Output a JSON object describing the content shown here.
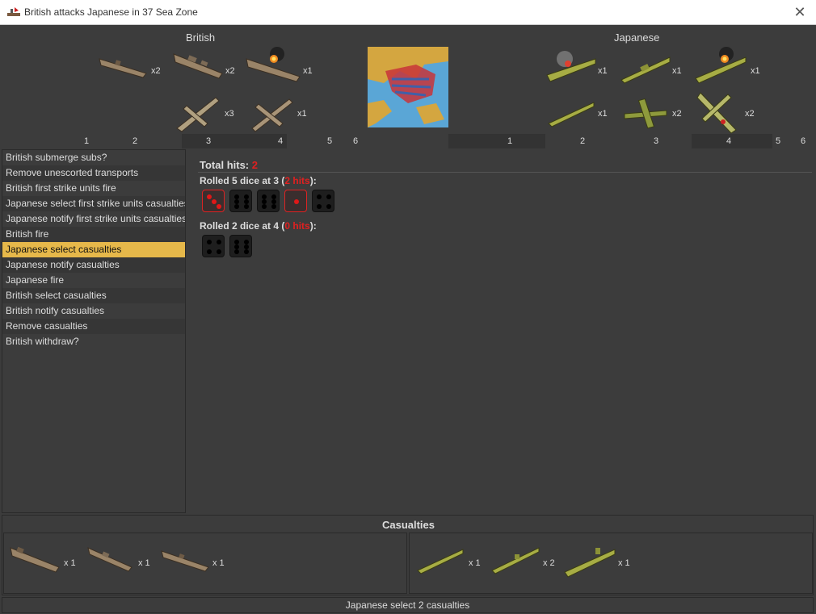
{
  "window": {
    "title": "British attacks Japanese in 37 Sea Zone",
    "close_label": "✕"
  },
  "british": {
    "label": "British",
    "units": [
      {
        "name": "submarine",
        "count": "x2"
      },
      {
        "name": "cruiser",
        "count": "x2"
      },
      {
        "name": "damaged-battleship",
        "count": "x1"
      },
      {
        "name": "fighter",
        "count": "x3"
      },
      {
        "name": "bomber",
        "count": "x1"
      }
    ]
  },
  "japanese": {
    "label": "Japanese",
    "units": [
      {
        "name": "damaged-carrier",
        "count": "x1"
      },
      {
        "name": "cruiser",
        "count": "x1"
      },
      {
        "name": "damaged-battleship",
        "count": "x1"
      },
      {
        "name": "destroyer",
        "count": "x1"
      },
      {
        "name": "tactical-bomber",
        "count": "x2"
      },
      {
        "name": "fighter",
        "count": "x2"
      }
    ]
  },
  "numbers": {
    "british": [
      "1",
      "2",
      "3",
      "4",
      "5",
      "6"
    ],
    "japanese": [
      "1",
      "2",
      "3",
      "4",
      "5",
      "6"
    ]
  },
  "steps": {
    "items": [
      "British submerge subs?",
      "Remove unescorted transports",
      "British first strike units fire",
      "Japanese select first strike units casualties",
      "Japanese notify first strike units casualties",
      "British fire",
      "Japanese select casualties",
      "Japanese notify casualties",
      "Japanese fire",
      "British select casualties",
      "British notify casualties",
      "Remove casualties",
      "British withdraw?"
    ],
    "selected_index": 6
  },
  "results": {
    "total_label": "Total hits:",
    "total_value": "2",
    "rolls": [
      {
        "prefix": "Rolled 5 dice at 3 (",
        "hits": "2 hits",
        "suffix": "):",
        "dice": [
          {
            "value": 3,
            "hit": true
          },
          {
            "value": 6,
            "hit": false
          },
          {
            "value": 6,
            "hit": false
          },
          {
            "value": 1,
            "hit": true
          },
          {
            "value": 4,
            "hit": false
          }
        ]
      },
      {
        "prefix": "Rolled 2 dice at 4 (",
        "hits": "0 hits",
        "suffix": "):",
        "dice": [
          {
            "value": 4,
            "hit": false
          },
          {
            "value": 6,
            "hit": false
          }
        ]
      }
    ]
  },
  "casualties": {
    "title": "Casualties",
    "british": [
      {
        "name": "carrier",
        "count": "x 1"
      },
      {
        "name": "cruiser",
        "count": "x 1"
      },
      {
        "name": "submarine",
        "count": "x 1"
      }
    ],
    "japanese": [
      {
        "name": "destroyer",
        "count": "x 1"
      },
      {
        "name": "submarine",
        "count": "x 2"
      },
      {
        "name": "carrier",
        "count": "x 1"
      }
    ]
  },
  "status": {
    "text": "Japanese select 2 casualties"
  },
  "colors": {
    "british_unit": "#9a8468",
    "japanese_unit": "#a7ad44",
    "hit_red": "#e02020",
    "selected_step": "#e6b84a"
  }
}
